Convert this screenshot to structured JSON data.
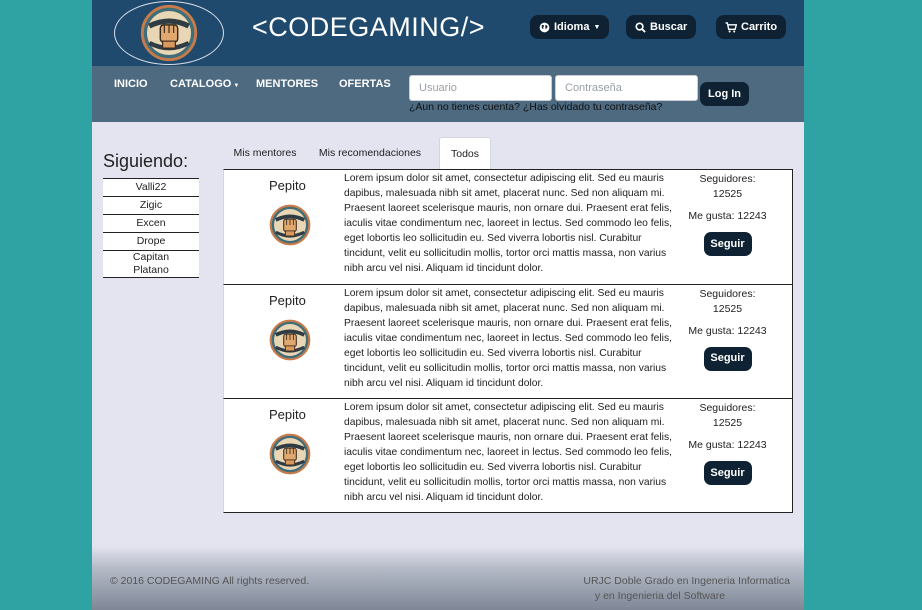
{
  "header": {
    "title": "<CODEGAMING/>",
    "language_label": "Idioma",
    "search_label": "Buscar",
    "cart_label": "Carrito"
  },
  "nav": {
    "items": [
      "INICIO",
      "CATALOGO",
      "MENTORES",
      "OFERTAS"
    ],
    "username_placeholder": "Usuario",
    "password_placeholder": "Contraseña",
    "login_label": "Log In",
    "no_account_link": "¿Aun no tienes cuenta?",
    "forgot_password_link": "¿Has olvidado tu contraseña?"
  },
  "sidebar": {
    "title": "Siguiendo:",
    "items": [
      "Valli22",
      "Zigic",
      "Excen",
      "Drope",
      "Capitan Platano"
    ]
  },
  "tabs": [
    {
      "label": "Mis mentores"
    },
    {
      "label": "Mis recomendaciones"
    },
    {
      "label": "Todos"
    }
  ],
  "cards": [
    {
      "name": "Pepito",
      "description": "Lorem ipsum dolor sit amet, consectetur adipiscing elit. Sed eu mauris dapibus, malesuada nibh sit amet, placerat nunc. Sed non aliquam mi. Praesent laoreet scelerisque mauris, non ornare dui. Praesent erat felis, iaculis vitae condimentum nec, laoreet in lectus. Sed commodo leo felis, eget lobortis leo sollicitudin eu. Sed viverra lobortis nisl. Curabitur tincidunt, velit eu sollicitudin mollis, tortor orci mattis massa, non varius nibh arcu vel nisi. Aliquam id tincidunt dolor.",
      "followers_label": "Seguidores:",
      "followers": "12525",
      "likes_label": "Me gusta:",
      "likes": "12243",
      "follow_label": "Seguir"
    },
    {
      "name": "Pepito",
      "description": "Lorem ipsum dolor sit amet, consectetur adipiscing elit. Sed eu mauris dapibus, malesuada nibh sit amet, placerat nunc. Sed non aliquam mi. Praesent laoreet scelerisque mauris, non ornare dui. Praesent erat felis, iaculis vitae condimentum nec, laoreet in lectus. Sed commodo leo felis, eget lobortis leo sollicitudin eu. Sed viverra lobortis nisl. Curabitur tincidunt, velit eu sollicitudin mollis, tortor orci mattis massa, non varius nibh arcu vel nisi. Aliquam id tincidunt dolor.",
      "followers_label": "Seguidores:",
      "followers": "12525",
      "likes_label": "Me gusta:",
      "likes": "12243",
      "follow_label": "Seguir"
    },
    {
      "name": "Pepito",
      "description": "Lorem ipsum dolor sit amet, consectetur adipiscing elit. Sed eu mauris dapibus, malesuada nibh sit amet, placerat nunc. Sed non aliquam mi. Praesent laoreet scelerisque mauris, non ornare dui. Praesent erat felis, iaculis vitae condimentum nec, laoreet in lectus. Sed commodo leo felis, eget lobortis leo sollicitudin eu. Sed viverra lobortis nisl. Curabitur tincidunt, velit eu sollicitudin mollis, tortor orci mattis massa, non varius nibh arcu vel nisi. Aliquam id tincidunt dolor.",
      "followers_label": "Seguidores:",
      "followers": "12525",
      "likes_label": "Me gusta:",
      "likes": "12243",
      "follow_label": "Seguir"
    }
  ],
  "footer": {
    "copyright": "© 2016 CODEGAMING All rights reserved.",
    "credit_line1": "URJC Doble Grado en Ingeneria Informatica",
    "credit_line2": "y en Ingenieria del Software"
  },
  "colors": {
    "header_bg": "#1f4a6e",
    "nav_bg": "#4e6a80",
    "button_bg": "#0e2233",
    "page_bg": "#e3e4f0",
    "outer_bg": "#2fa3a3"
  }
}
